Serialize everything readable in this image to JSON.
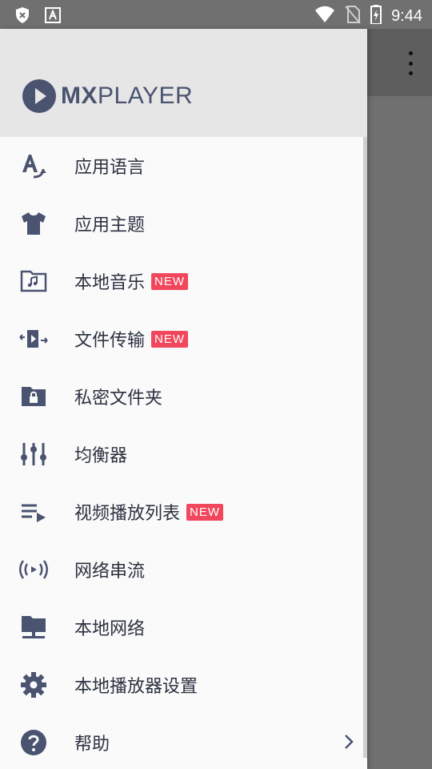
{
  "status_bar": {
    "time": "9:44",
    "icons": [
      "shield-x-icon",
      "keyboard-a-icon",
      "wifi-icon",
      "no-sim-icon",
      "battery-charging-icon"
    ]
  },
  "drawer": {
    "logo": {
      "mx": "MX",
      "player": "PLAYER"
    },
    "items": [
      {
        "label": "应用语言",
        "icon": "translate-icon",
        "badge": ""
      },
      {
        "label": "应用主题",
        "icon": "tshirt-icon",
        "badge": ""
      },
      {
        "label": "本地音乐",
        "icon": "music-folder-icon",
        "badge": "NEW"
      },
      {
        "label": "文件传输",
        "icon": "file-transfer-icon",
        "badge": "NEW"
      },
      {
        "label": "私密文件夹",
        "icon": "lock-folder-icon",
        "badge": ""
      },
      {
        "label": "均衡器",
        "icon": "equalizer-icon",
        "badge": ""
      },
      {
        "label": "视频播放列表",
        "icon": "playlist-icon",
        "badge": "NEW"
      },
      {
        "label": "网络串流",
        "icon": "stream-icon",
        "badge": ""
      },
      {
        "label": "本地网络",
        "icon": "network-folder-icon",
        "badge": ""
      },
      {
        "label": "本地播放器设置",
        "icon": "gear-icon",
        "badge": ""
      },
      {
        "label": "帮助",
        "icon": "help-icon",
        "badge": ""
      }
    ]
  },
  "colors": {
    "icon": "#4a5370",
    "badge": "#f0475c",
    "text": "#2b3140"
  }
}
